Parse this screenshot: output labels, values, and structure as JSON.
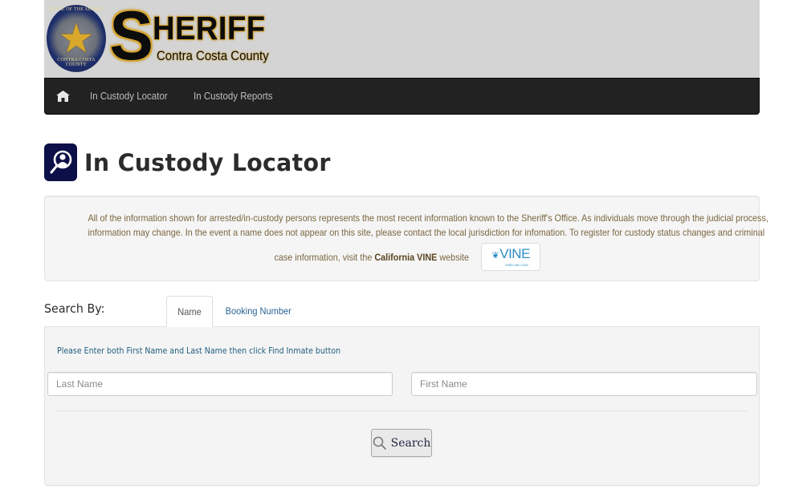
{
  "header": {
    "seal_top_text": "OFFICE OF THE SHERIFF",
    "seal_bottom_text": "CONTRA COSTA COUNTY",
    "logo_big_letter": "S",
    "logo_rest": "HERIFF",
    "logo_subtitle": "Contra Costa County"
  },
  "nav": {
    "home_icon": "home-icon",
    "links": [
      {
        "label": "In Custody Locator"
      },
      {
        "label": "In Custody Reports"
      }
    ]
  },
  "page": {
    "title_icon": "person-search-icon",
    "title": "In Custody Locator"
  },
  "info": {
    "line1": "All of the information shown for arrested/in-custody persons represents the most recent information known to the Sheriff's Office. As individuals move through the judicial process,",
    "line2": "information may change. In the event a name does not appear on this site, please contact the local jurisdiction for infomation. To register for custody status changes and criminal",
    "line3_prefix": "case information, visit the",
    "line3_bold": "California VINE",
    "line3_suffix": "website",
    "vine_logo_text": "VINE",
    "vine_logo_subtext": "VINELINK.COM"
  },
  "search": {
    "label": "Search By:",
    "tabs": [
      {
        "label": "Name",
        "active": true
      },
      {
        "label": "Booking Number",
        "active": false
      }
    ],
    "instructions": "Please Enter both First Name and Last Name then click Find Inmate button",
    "last_name": {
      "value": "",
      "placeholder": "Last Name"
    },
    "first_name": {
      "value": "",
      "placeholder": "First Name"
    },
    "button_label": "Search",
    "button_icon": "magnifier-icon"
  },
  "colors": {
    "navbar_bg": "#222222",
    "header_bg": "#d4d4d4",
    "info_text": "#7a6540",
    "link_blue": "#2a6496",
    "instruction_blue": "#1f5d7e",
    "title_icon_bg": "#0d0f48"
  }
}
